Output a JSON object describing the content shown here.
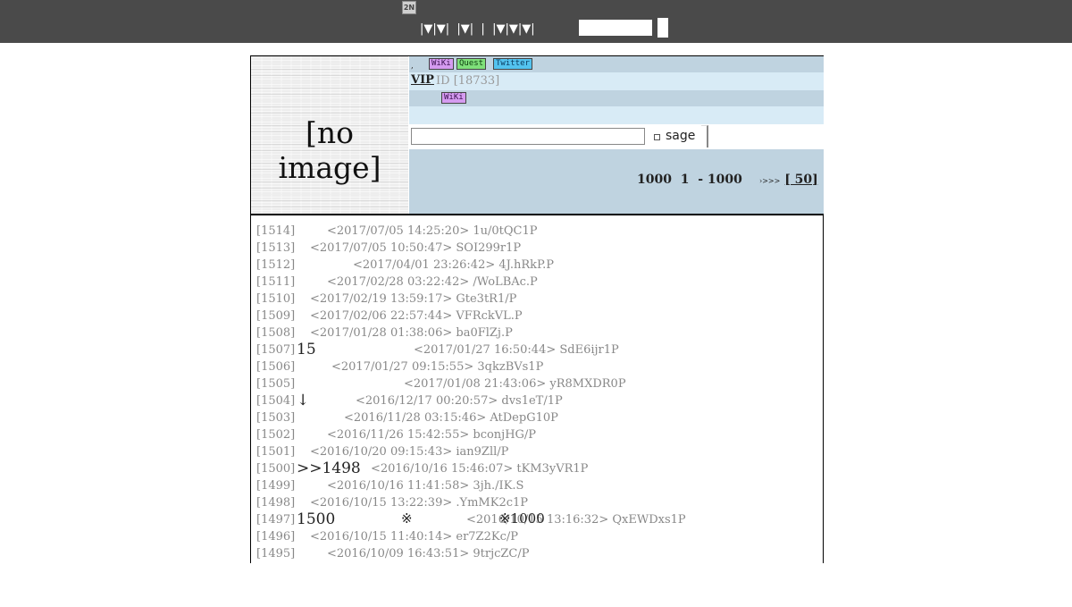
{
  "topbar": {
    "logo": "2N",
    "nav": "|▼|▼|  |▼|  |  |▼|▼|▼|",
    "search_placeholder": ""
  },
  "thread": {
    "no_image": "[no image]",
    "tags_row1": [
      "WiKi",
      "Quest",
      "Twitter"
    ],
    "vip": "VIP",
    "id": "ID [18733]",
    "tag_row3": "WiKi",
    "sage": "sage",
    "range": "1000  1  - 1000",
    "next_prefix": "›>>>",
    "next_link": "[ 50]"
  },
  "posts": [
    {
      "num": "[1514]",
      "date": "<2017/07/05 14:25:20>",
      "id": "1u/0tQC1P",
      "body": ""
    },
    {
      "num": "[1513]",
      "date": "<2017/07/05 10:50:47>",
      "id": "SOI299r1P",
      "body": ""
    },
    {
      "num": "[1512]",
      "date": "<2017/04/01 23:26:42>",
      "id": "4J.hRkP.P",
      "body": ""
    },
    {
      "num": "[1511]",
      "date": "<2017/02/28 03:22:42>",
      "id": "/WoLBAc.P",
      "body": ""
    },
    {
      "num": "[1510]",
      "date": "<2017/02/19 13:59:17>",
      "id": "Gte3tR1/P",
      "body": ""
    },
    {
      "num": "[1509]",
      "date": "<2017/02/06 22:57:44>",
      "id": "VFRckVL.P",
      "body": ""
    },
    {
      "num": "[1508]",
      "date": "<2017/01/28 01:38:06>",
      "id": "ba0FlZj.P",
      "body": ""
    },
    {
      "num": "[1507]",
      "date": "<2017/01/27 16:50:44>",
      "id": "SdE6ijr1P",
      "body": "15"
    },
    {
      "num": "[1506]",
      "date": "<2017/01/27 09:15:55>",
      "id": "3qkzBVs1P",
      "body": ""
    },
    {
      "num": "[1505]",
      "date": "<2017/01/08 21:43:06>",
      "id": "yR8MXDR0P",
      "body": ""
    },
    {
      "num": "[1504]",
      "date": "<2016/12/17 00:20:57>",
      "id": "dvs1eT/1P",
      "body": "↓"
    },
    {
      "num": "[1503]",
      "date": "<2016/11/28 03:15:46>",
      "id": "AtDepG10P",
      "body": ""
    },
    {
      "num": "[1502]",
      "date": "<2016/11/26 15:42:55>",
      "id": "bconjHG/P",
      "body": ""
    },
    {
      "num": "[1501]",
      "date": "<2016/10/20 09:15:43>",
      "id": "ian9Zll/P",
      "body": ""
    },
    {
      "num": "[1500]",
      "date": "<2016/10/16 15:46:07>",
      "id": "tKM3yVR1P",
      "body": ">>1498"
    },
    {
      "num": "[1499]",
      "date": "<2016/10/16 11:41:58>",
      "id": "3jh./IK.S",
      "body": ""
    },
    {
      "num": "[1498]",
      "date": "<2016/10/15 13:22:39>",
      "id": ".YmMK2c1P",
      "body": ""
    },
    {
      "num": "[1497]",
      "date": "<2016/10/15 13:16:32>",
      "id": "QxEWDxs1P",
      "body": "1500",
      "mark1": "※",
      "mark2": "※1000"
    },
    {
      "num": "[1496]",
      "date": "<2016/10/15 11:40:14>",
      "id": "er7Z2Kc/P",
      "body": ""
    },
    {
      "num": "[1495]",
      "date": "<2016/10/09 16:43:51>",
      "id": "9trjcZC/P",
      "body": ""
    }
  ]
}
